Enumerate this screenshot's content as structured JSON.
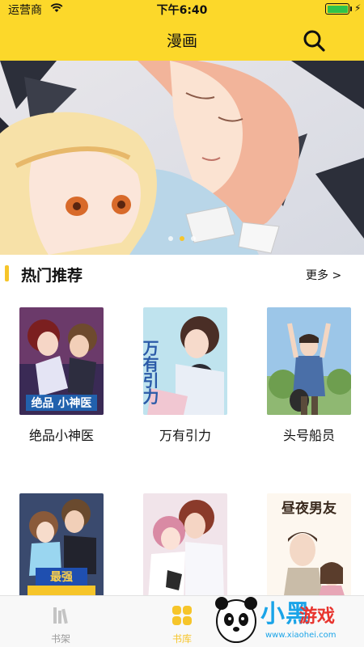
{
  "status_bar": {
    "carrier": "运营商",
    "time": "下午6:40"
  },
  "header": {
    "title": "漫画",
    "search_icon": "search-icon"
  },
  "banner": {
    "slide_count": 3,
    "active_slide": 2
  },
  "hot_section": {
    "title": "热门推荐",
    "more_label": "更多 >"
  },
  "comics": [
    {
      "title": "绝品小神医",
      "cover_text": "绝品 小神医"
    },
    {
      "title": "万有引力",
      "cover_text": "万有引力"
    },
    {
      "title": "头号船员",
      "cover_text": ""
    },
    {
      "title": "",
      "cover_text": "最强"
    },
    {
      "title": "",
      "cover_text": ""
    },
    {
      "title": "",
      "cover_text": "昼夜男友"
    }
  ],
  "tabbar": {
    "tabs": [
      {
        "label": "书架",
        "icon": "bookshelf-icon",
        "active": false
      },
      {
        "label": "书库",
        "icon": "library-grid-icon",
        "active": true
      }
    ]
  },
  "watermark": {
    "text": "小黑",
    "sub": "游戏",
    "url": "www.xiaohei.com"
  },
  "colors": {
    "accent": "#fcd82a",
    "active_tab": "#f6c52a",
    "inactive_tab": "#9a9a9a",
    "battery": "#2fc34a"
  }
}
